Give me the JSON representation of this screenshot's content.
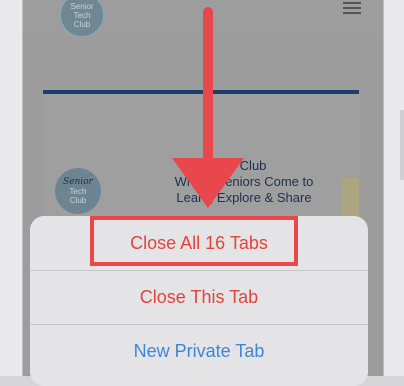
{
  "page": {
    "logo_lines": [
      "Senior",
      "Tech",
      "Club"
    ]
  },
  "hero": {
    "logo_script": "Senior",
    "logo_lines": [
      "Tech",
      "Club"
    ],
    "text_lines": [
      "ne Club",
      "Where Seniors Come to",
      "Learn, Explore & Share"
    ]
  },
  "action_sheet": {
    "items": [
      {
        "label": "Close All 16 Tabs",
        "color": "#e2433a"
      },
      {
        "label": "Close This Tab",
        "color": "#e2433a"
      },
      {
        "label": "New Private Tab",
        "color": "#3d86d6"
      }
    ]
  },
  "annotation": {
    "color": "#e8474c",
    "icon": "arrow-down-icon"
  }
}
